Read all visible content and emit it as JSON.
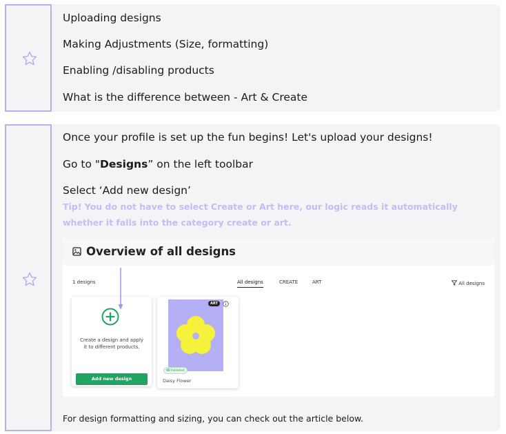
{
  "card1": {
    "items": [
      "Uploading designs",
      "Making Adjustments (Size, formatting)",
      "Enabling /disabling products",
      "What is the difference between - Art & Create"
    ]
  },
  "card2": {
    "intro": "Once your profile is set up the fun begins! Let's upload your designs!",
    "goto_prefix": "Go to \"",
    "goto_bold": "Designs",
    "goto_suffix": "” on the left toolbar",
    "select": "Select ‘Add new design’",
    "tip": "Tip! You do not have to select Create or Art here, our logic reads it automatically whether it falls into the category create or art.",
    "footer": "For design formatting and sizing, you can check out the article below."
  },
  "screenshot": {
    "title": "Overview of all designs",
    "count": "1 designs",
    "tabs": [
      "All designs",
      "CREATE",
      "ART"
    ],
    "filter": "All designs",
    "create_tile": {
      "text": "Create a design and apply it to different products.",
      "button": "Add new design"
    },
    "design_tile": {
      "badge": "ART",
      "status": "Published",
      "name": "Daisy Flower"
    }
  },
  "colors": {
    "accent_lavender": "#b3b1f0",
    "tip_text": "#c2bdf4",
    "card_bg": "#f4f4f6",
    "green": "#1fa463",
    "flower_yellow": "#f6f23c",
    "flower_bg": "#b5b0f6"
  },
  "icons": [
    "star-icon",
    "image-icon",
    "plus-circle-icon",
    "filter-icon",
    "info-icon",
    "eye-icon"
  ]
}
